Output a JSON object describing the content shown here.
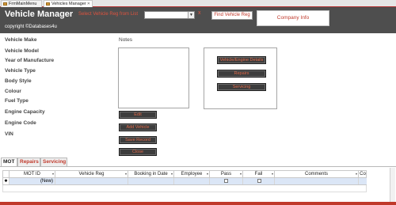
{
  "tabs": [
    {
      "label": "FrmMainMenu"
    },
    {
      "label": "Vehicles Manager"
    }
  ],
  "header": {
    "title": "Vehicle Manager",
    "copyright": "copyright  ©Databases4u",
    "reg_label": "Select Vehicle Reg from List",
    "reg_value": "",
    "clear": "x",
    "find_label": "Find Vehicle Reg",
    "company_label": "Company Info"
  },
  "fields": [
    "Vehicle Make",
    "Vehicle Model",
    "Year of Manufacture",
    "Vehicle Type",
    "Body Style",
    "Colour",
    "Fuel Type",
    "Engine Capacity",
    "Engine Code",
    "VIN"
  ],
  "notes_label": "Notes",
  "panel_buttons": [
    "Vehicle/Engine Details",
    "Repairs",
    "Servicing"
  ],
  "left_buttons": [
    "Edit",
    "Add Vehicle",
    "Save Record",
    "Close"
  ],
  "subtabs": [
    "MOT",
    "Repairs",
    "Servicing"
  ],
  "grid": {
    "columns": [
      "MOT ID",
      "Vehicle Reg",
      "Booking in Date",
      "Employee",
      "Pass",
      "Fail",
      "Comments",
      "Co"
    ],
    "new_row": {
      "selector": "✱",
      "mot_id": "(New)"
    }
  },
  "colors": {
    "header_bg": "#4e4e4e",
    "accent": "#c0392b",
    "button_bg": "#3d3d3d"
  }
}
